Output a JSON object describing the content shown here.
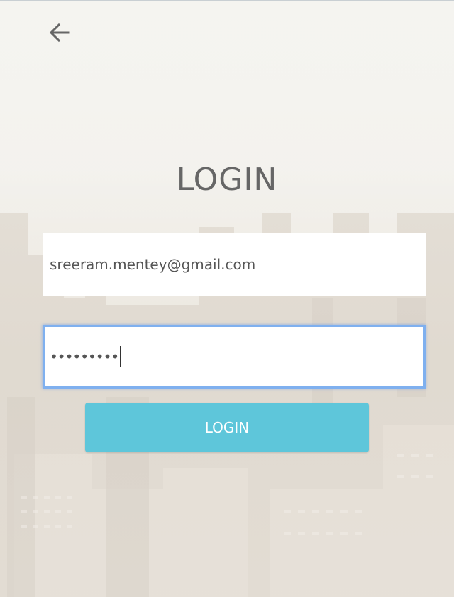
{
  "header": {
    "back_icon": "arrow-left-icon"
  },
  "login": {
    "title": "LOGIN",
    "email_value": "sreeram.mentey@gmail.com",
    "password_value": "•••••••••",
    "button_label": "LOGIN"
  },
  "colors": {
    "button": "#5ec6da",
    "title_text": "#666666",
    "focus_border": "#7fb0ef"
  }
}
